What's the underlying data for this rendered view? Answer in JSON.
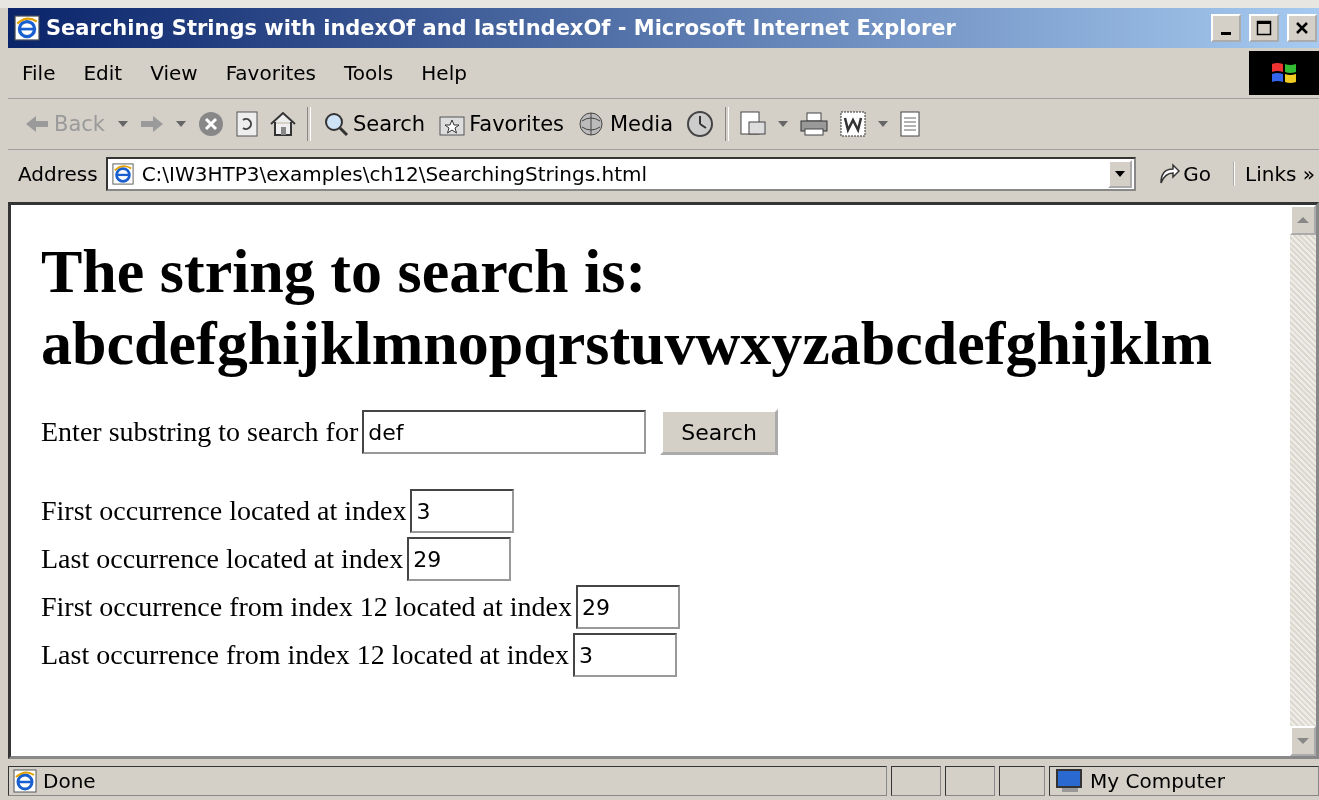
{
  "window": {
    "title": "Searching Strings with indexOf and lastIndexOf - Microsoft Internet Explorer"
  },
  "menu": [
    "File",
    "Edit",
    "View",
    "Favorites",
    "Tools",
    "Help"
  ],
  "toolbar": [
    {
      "kind": "back",
      "label": "Back",
      "disabled": true
    },
    {
      "kind": "search",
      "label": "Search",
      "disabled": false
    },
    {
      "kind": "favorites",
      "label": "Favorites",
      "disabled": false
    },
    {
      "kind": "media",
      "label": "Media",
      "disabled": false
    }
  ],
  "address": {
    "label": "Address",
    "value": "C:\\IW3HTP3\\examples\\ch12\\SearchingStrings.html",
    "go": "Go",
    "links": "Links",
    "links_more": "»"
  },
  "page": {
    "heading": "The string to search is:",
    "string": "abcdefghijklmnopqrstuvwxyzabcdefghijklm",
    "search": {
      "label": "Enter substring to search for",
      "value": "def",
      "button": "Search"
    },
    "results": [
      {
        "label": "First occurrence located at index",
        "value": "3"
      },
      {
        "label": "Last occurrence located at index",
        "value": "29"
      },
      {
        "label": "First occurrence from index 12 located at index",
        "value": "29"
      },
      {
        "label": "Last occurrence from index 12 located at index",
        "value": "3"
      }
    ]
  },
  "status_bar": {
    "text": "Done",
    "zone": "My Computer"
  }
}
